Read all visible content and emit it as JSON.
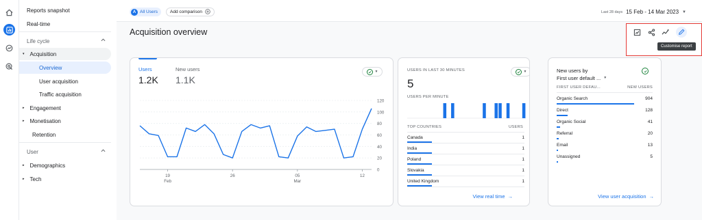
{
  "rail": {
    "icons": [
      "home-icon",
      "reports-icon",
      "explore-icon",
      "advertising-icon"
    ]
  },
  "nav": {
    "reports_snapshot": "Reports snapshot",
    "realtime": "Real-time",
    "life_cycle": "Life cycle",
    "acquisition": "Acquisition",
    "overview": "Overview",
    "user_acquisition": "User acquisition",
    "traffic_acquisition": "Traffic acquisition",
    "engagement": "Engagement",
    "monetisation": "Monetisation",
    "retention": "Retention",
    "user": "User",
    "demographics": "Demographics",
    "tech": "Tech"
  },
  "topbar": {
    "segment_avatar": "A",
    "segment_label": "All Users",
    "add_comparison": "Add comparison",
    "date_caption": "Last 28 days",
    "date_range": "15 Feb - 14 Mar 2023"
  },
  "page": {
    "title": "Acquisition overview",
    "tooltip": "Customise report"
  },
  "card1": {
    "metric1_label": "Users",
    "metric1_value": "1.2K",
    "metric2_label": "New users",
    "metric2_value": "1.1K"
  },
  "card2": {
    "heading": "USERS IN LAST 30 MINUTES",
    "value": "5",
    "per_minute": "USERS PER MINUTE",
    "col1": "TOP COUNTRIES",
    "col2": "USERS",
    "rows": [
      {
        "name": "Canada",
        "value": "1"
      },
      {
        "name": "India",
        "value": "1"
      },
      {
        "name": "Poland",
        "value": "1"
      },
      {
        "name": "Slovakia",
        "value": "1"
      },
      {
        "name": "United Kingdom",
        "value": "1"
      }
    ],
    "link": "View real time"
  },
  "card3": {
    "title1": "New users by",
    "title2": "First user default ...",
    "col1": "FIRST USER DEFAU...",
    "col2": "NEW USERS",
    "rows": [
      {
        "name": "Organic Search",
        "value": "904"
      },
      {
        "name": "Direct",
        "value": "128"
      },
      {
        "name": "Organic Social",
        "value": "41"
      },
      {
        "name": "Referral",
        "value": "20"
      },
      {
        "name": "Email",
        "value": "13"
      },
      {
        "name": "Unassigned",
        "value": "5"
      }
    ],
    "link": "View user acquisition"
  },
  "colors": {
    "accent": "#1a73e8",
    "highlight_border": "#e53935",
    "check": "#188038"
  },
  "chart_data": [
    {
      "type": "line",
      "series": [
        {
          "values": [
            76,
            62,
            59,
            22,
            22,
            72,
            66,
            78,
            62,
            26,
            20,
            66,
            78,
            72,
            76,
            22,
            20,
            58,
            74,
            66,
            68,
            70,
            20,
            22,
            70,
            106
          ]
        }
      ],
      "x_tick_labels": [
        "19",
        "26",
        "05",
        "12"
      ],
      "x_tick_sublabels": [
        "Feb",
        "",
        "Mar",
        ""
      ],
      "y_tick_labels": [
        "120",
        "100",
        "80",
        "60",
        "40",
        "20",
        "0"
      ],
      "ylim": [
        0,
        120
      ],
      "grid": true
    },
    {
      "type": "bar",
      "title": "USERS PER MINUTE",
      "values": [
        0,
        0,
        0,
        0,
        0,
        0,
        0,
        0,
        0,
        1,
        0,
        1,
        0,
        0,
        0,
        0,
        0,
        0,
        0,
        1,
        0,
        0,
        1,
        1,
        0,
        1,
        0,
        0,
        0,
        1
      ]
    },
    {
      "type": "bar",
      "title": "TOP COUNTRIES",
      "categories": [
        "Canada",
        "India",
        "Poland",
        "Slovakia",
        "United Kingdom"
      ],
      "values": [
        1,
        1,
        1,
        1,
        1
      ]
    },
    {
      "type": "bar",
      "title": "New users by First user default ...",
      "categories": [
        "Organic Search",
        "Direct",
        "Organic Social",
        "Referral",
        "Email",
        "Unassigned"
      ],
      "values": [
        904,
        128,
        41,
        20,
        13,
        5
      ]
    }
  ]
}
